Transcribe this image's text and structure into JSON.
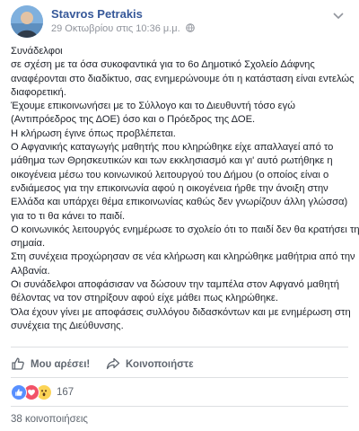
{
  "post": {
    "author": "Stavros Petrakis",
    "timestamp": "29 Οκτωβρίου στις 10:36 μ.μ.",
    "privacy_icon": "globe-icon",
    "body_lines": [
      "Συνάδελφοι",
      "σε σχέση με τα όσα συκοφαντικά για το 6ο Δημοτικό Σχολείο Δάφνης",
      "αναφέρονται στο διαδίκτυο, σας ενημερώνουμε ότι η κατάσταση είναι εντελώς",
      "διαφορετική.",
      "Έχουμε επικοινωνήσει με το Σύλλογο και το Διευθυντή τόσο εγώ",
      "(Αντιπρόεδρος της ΔΟΕ) όσο και ο Πρόεδρος της ΔΟΕ.",
      "Η κλήρωση έγινε όπως προβλέπεται.",
      "Ο Αφγανικής καταγωγής μαθητής που κληρώθηκε είχε απαλλαγεί από το",
      "μάθημα των Θρησκευτικών και των εκκλησιασμό και γι' αυτό ρωτήθηκε η",
      "οικογένεια μέσω του κοινωνικού λειτουργού του Δήμου (ο οποίος είναι ο",
      "ενδιάμεσος για την επικοινωνία αφού η οικογένεια ήρθε την άνοιξη στην",
      "Ελλάδα και υπάρχει θέμα επικοινωνίας καθώς δεν γνωρίζουν άλλη γλώσσα)",
      "για το τι θα κάνει το παιδί.",
      "Ο κοινωνικός λειτουργός ενημέρωσε το σχολείο ότι το παιδί δεν θα κρατήσει τη",
      "σημαία.",
      "Στη συνέχεια προχώρησαν σε νέα κλήρωση και κληρώθηκε μαθήτρια από την",
      "Αλβανία.",
      "Οι συνάδελφοι αποφάσισαν να δώσουν την ταμπέλα στον Αφγανό μαθητή",
      "θέλοντας να τον στηρίξουν αφού είχε μάθει πως κληρώθηκε.",
      "Όλα έχουν γίνει με αποφάσεις συλλόγου διδασκόντων και με ενημέρωση στη",
      "συνέχεια της Διεύθυνσης."
    ]
  },
  "actions": {
    "like_label": "Μου αρέσει!",
    "share_label": "Κοινοποιήστε"
  },
  "reactions": {
    "icons": [
      "like-icon",
      "love-icon",
      "wow-icon"
    ],
    "count": "167"
  },
  "shares": {
    "label": "38 κοινοποιήσεις"
  },
  "colors": {
    "author": "#365899",
    "like_blue": "#5890ff",
    "love_red": "#f25268",
    "wow_yellow": "#fcd456",
    "muted": "#606770"
  }
}
